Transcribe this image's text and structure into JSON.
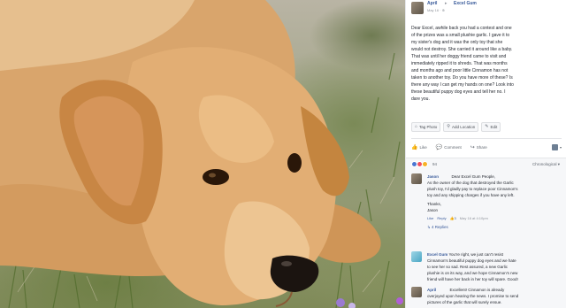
{
  "post": {
    "author": "April",
    "arrow": "▸",
    "page": "Excel Gum",
    "date": "May 16 · ⊕",
    "body_lines": [
      "Dear Excel, awhile back you had a contest and one",
      "of the prizes was a small plushie garlic. I gave it to",
      "my sister's dog and it was the only toy that she",
      "would not destroy. She carried it around like a baby.",
      "That was until her doggy friend came to visit and",
      "immediately ripped it to shreds. That was months",
      "and months ago and poor little Cinnamon has not",
      "taken to another toy. Do you have more of these? Is",
      "there any way I can get my hands on one? Look into",
      "these beautiful puppy dog eyes and tell her no. I",
      "dare you."
    ]
  },
  "actions": {
    "tag_photo": "Tag Photo",
    "add_location": "Add Location",
    "edit": "Edit"
  },
  "like_bar": {
    "like": "Like",
    "comment": "Comment",
    "share": "Share"
  },
  "reactions": {
    "count": "94",
    "sort": "Chronological ▾",
    "colors": [
      "#4a76d1",
      "#f04f5f",
      "#f7b125"
    ]
  },
  "comments": [
    {
      "name": "Jason",
      "lines": [
        "                      Dear Excel Gum People,",
        "As the owner of the dog that destroyed the Garlic",
        "plush toy, I'd gladly pay to replace poor Cinnamon's",
        "toy and any shipping charges if you have any left.",
        "Thanks,",
        "Jason"
      ],
      "meta": [
        "Like",
        "Reply",
        "👍3",
        "May 16 at 4:10pm"
      ],
      "replies": "↳ 4 Replies"
    },
    {
      "name": "Excel Gum",
      "lines": [
        "You're right, we just can't resist",
        "Cinnamon's beautiful puppy dog eyes and we hate",
        "to see her so sad. Rest assured, a new Garlic",
        "plushie is on its way, and we hope Cinnamon's new",
        "friend will have her back in her toy will spare. Good!"
      ]
    },
    {
      "name": "April",
      "lines": [
        "Excellent! Cinnamon is already",
        "overjoyed upon hearing the news. I promise to send",
        "pictures of the garlic that will surely ensue."
      ]
    }
  ]
}
